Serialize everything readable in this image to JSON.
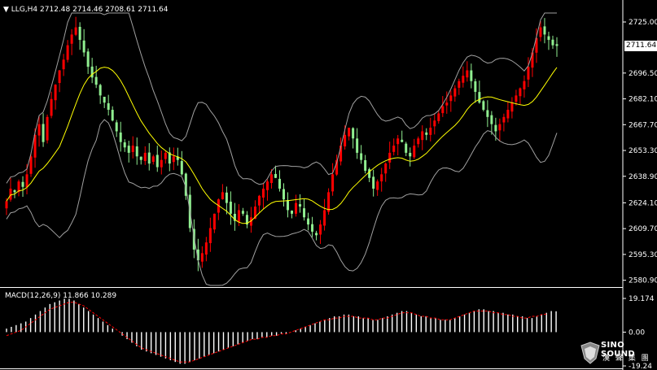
{
  "header": {
    "arrow_icon": "triangle-down-icon",
    "symbol": "LLG,H4",
    "ohlc": "2712.48 2714.46 2708.61 2711.64"
  },
  "current_price": "2711.64",
  "macd_label": "MACD(12,26,9) 11.866 10.289",
  "logo": {
    "name": "SINO SOUND",
    "chinese": "漢 聲 集 團",
    "icon": "gem-logo-icon"
  },
  "colors": {
    "background": "#000000",
    "bull": "#ff0000",
    "bear": "#90ee90",
    "ma": "#ffff00",
    "bands": "#a0a0a0",
    "macd_hist": "#ffffff",
    "signal": "#ff0000",
    "axis_text": "#ffffff"
  },
  "chart_data": [
    {
      "type": "candlestick",
      "title": "LLG,H4",
      "overlays": [
        "moving average (yellow)",
        "Bollinger-style bands (grey)"
      ],
      "price_axis_ticks": [
        "2725.00",
        "2711.64",
        "2696.50",
        "2682.10",
        "2667.70",
        "2653.30",
        "2638.90",
        "2624.10",
        "2609.70",
        "2595.30",
        "2580.90"
      ],
      "ylim": [
        2578,
        2730
      ],
      "close": [
        2625,
        2632,
        2630,
        2636,
        2633,
        2640,
        2650,
        2662,
        2668,
        2658,
        2672,
        2682,
        2690,
        2698,
        2704,
        2712,
        2718,
        2722,
        2715,
        2708,
        2700,
        2694,
        2690,
        2684,
        2680,
        2676,
        2670,
        2664,
        2658,
        2655,
        2652,
        2656,
        2650,
        2648,
        2652,
        2646,
        2650,
        2644,
        2648,
        2652,
        2646,
        2650,
        2648,
        2640,
        2628,
        2610,
        2598,
        2592,
        2596,
        2602,
        2610,
        2618,
        2626,
        2630,
        2624,
        2618,
        2614,
        2620,
        2618,
        2612,
        2616,
        2622,
        2628,
        2632,
        2636,
        2640,
        2638,
        2632,
        2626,
        2620,
        2618,
        2624,
        2622,
        2616,
        2612,
        2608,
        2606,
        2612,
        2620,
        2630,
        2640,
        2648,
        2656,
        2662,
        2666,
        2660,
        2652,
        2648,
        2642,
        2638,
        2632,
        2636,
        2640,
        2646,
        2652,
        2656,
        2660,
        2658,
        2652,
        2650,
        2656,
        2660,
        2664,
        2662,
        2666,
        2670,
        2674,
        2678,
        2680,
        2684,
        2688,
        2692,
        2695,
        2698,
        2692,
        2686,
        2680,
        2676,
        2672,
        2668,
        2664,
        2668,
        2672,
        2676,
        2680,
        2684,
        2688,
        2692,
        2700,
        2708,
        2716,
        2722,
        2718,
        2715,
        2712,
        2711.64
      ],
      "spread": 8
    },
    {
      "type": "bar",
      "title": "MACD(12,26,9) 11.866 10.289",
      "macd_axis_ticks": [
        "19.174",
        "0.00",
        "-19.24"
      ],
      "ylim": [
        -19.24,
        19.174
      ],
      "series": [
        {
          "name": "MACD",
          "values": [
            2,
            3,
            4,
            5,
            6,
            8,
            10,
            12,
            14,
            16,
            17,
            18,
            19,
            19,
            18,
            16,
            14,
            12,
            10,
            8,
            6,
            4,
            2,
            0,
            -2,
            -4,
            -6,
            -8,
            -10,
            -11,
            -12,
            -13,
            -14,
            -15,
            -16,
            -17,
            -18,
            -18,
            -17,
            -16,
            -15,
            -14,
            -13,
            -12,
            -11,
            -10,
            -9,
            -8,
            -7,
            -6,
            -5,
            -4,
            -4,
            -3,
            -3,
            -2,
            -2,
            -1,
            -1,
            0,
            1,
            2,
            3,
            4,
            5,
            6,
            7,
            8,
            9,
            9,
            10,
            10,
            9,
            9,
            8,
            8,
            7,
            7,
            8,
            9,
            10,
            11,
            12,
            12,
            11,
            10,
            9,
            9,
            8,
            8,
            7,
            7,
            7,
            8,
            9,
            10,
            11,
            12,
            13,
            13,
            12,
            12,
            11,
            11,
            10,
            10,
            9,
            9,
            8,
            8,
            9,
            10,
            11,
            12,
            11.866
          ]
        },
        {
          "name": "Signal",
          "values": [
            -2,
            -1,
            0,
            1,
            3,
            5,
            7,
            9,
            11,
            13,
            14,
            15,
            16,
            17,
            17,
            16,
            15,
            13,
            11,
            9,
            7,
            5,
            3,
            1,
            -1,
            -3,
            -5,
            -7,
            -9,
            -10,
            -11,
            -12,
            -13,
            -14,
            -15,
            -16,
            -17,
            -17,
            -17,
            -16,
            -15,
            -14,
            -13,
            -12,
            -11,
            -10,
            -9,
            -8,
            -7,
            -6,
            -5,
            -4,
            -4,
            -3,
            -3,
            -2,
            -2,
            -1,
            -1,
            0,
            1,
            2,
            3,
            4,
            5,
            6,
            7,
            7,
            8,
            8,
            9,
            9,
            9,
            8,
            8,
            8,
            7,
            7,
            8,
            8,
            9,
            10,
            11,
            11,
            11,
            10,
            9,
            9,
            8,
            8,
            7,
            7,
            7,
            8,
            9,
            10,
            11,
            12,
            12,
            12,
            12,
            11,
            11,
            10,
            10,
            9,
            9,
            8,
            8,
            9,
            9,
            10,
            10.289
          ]
        }
      ]
    }
  ]
}
